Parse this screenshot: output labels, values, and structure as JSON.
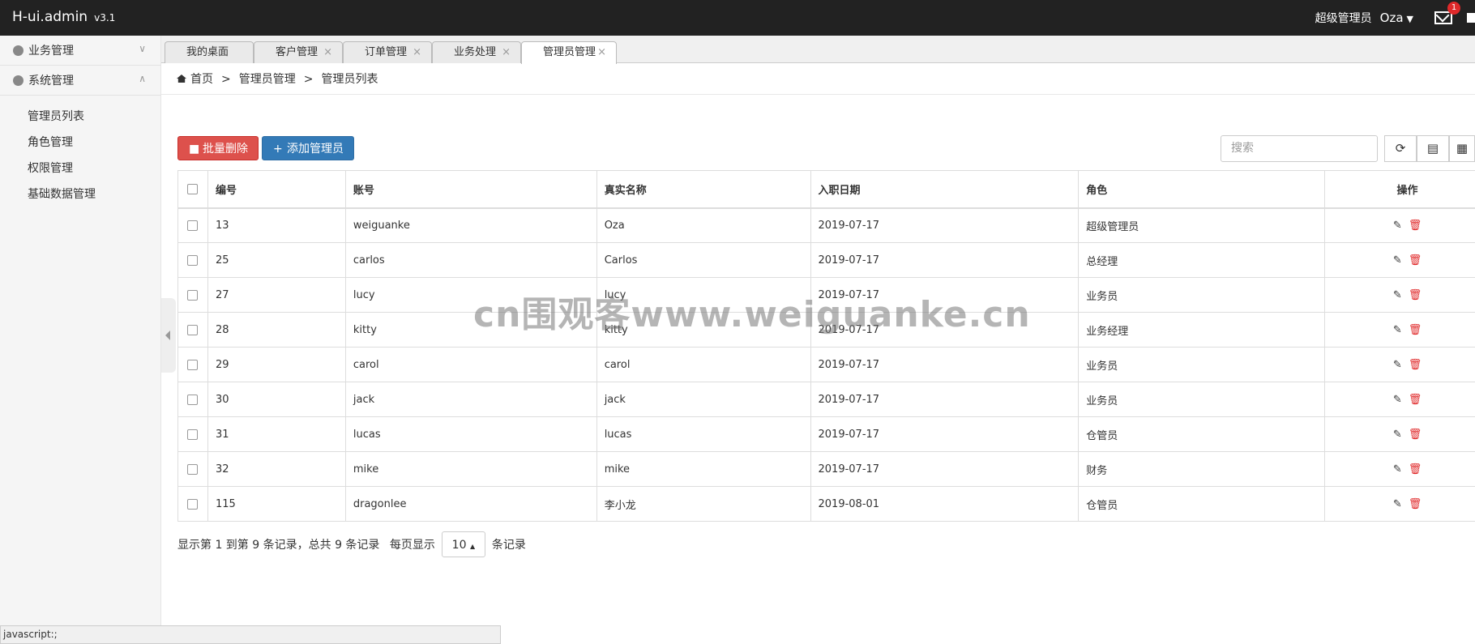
{
  "header": {
    "brand": "H-ui.admin",
    "version": "v3.1",
    "role": "超级管理员",
    "user": "Oza",
    "mail_badge": "1"
  },
  "sidebar": {
    "groups": [
      {
        "label": "业务管理",
        "icon": "user-icon",
        "expanded": false
      },
      {
        "label": "系统管理",
        "icon": "gear-icon",
        "expanded": true
      }
    ],
    "items": [
      "管理员列表",
      "角色管理",
      "权限管理",
      "基础数据管理"
    ]
  },
  "tabs": [
    {
      "label": "我的桌面",
      "closable": false
    },
    {
      "label": "客户管理",
      "closable": true
    },
    {
      "label": "订单管理",
      "closable": true
    },
    {
      "label": "业务处理",
      "closable": true
    },
    {
      "label": "管理员管理",
      "closable": true,
      "active": true
    }
  ],
  "breadcrumb": {
    "home": "首页",
    "level1": "管理员管理",
    "level2": "管理员列表",
    "sep": ">"
  },
  "toolbar": {
    "batch_delete": "批量删除",
    "add_admin": "添加管理员",
    "search_placeholder": "搜索"
  },
  "table": {
    "columns": [
      "编号",
      "账号",
      "真实名称",
      "入职日期",
      "角色",
      "操作"
    ],
    "rows": [
      {
        "id": "13",
        "account": "weiguanke",
        "name": "Oza",
        "date": "2019-07-17",
        "role": "超级管理员"
      },
      {
        "id": "25",
        "account": "carlos",
        "name": "Carlos",
        "date": "2019-07-17",
        "role": "总经理"
      },
      {
        "id": "27",
        "account": "lucy",
        "name": "lucy",
        "date": "2019-07-17",
        "role": "业务员"
      },
      {
        "id": "28",
        "account": "kitty",
        "name": "kitty",
        "date": "2019-07-17",
        "role": "业务经理"
      },
      {
        "id": "29",
        "account": "carol",
        "name": "carol",
        "date": "2019-07-17",
        "role": "业务员"
      },
      {
        "id": "30",
        "account": "jack",
        "name": "jack",
        "date": "2019-07-17",
        "role": "业务员"
      },
      {
        "id": "31",
        "account": "lucas",
        "name": "lucas",
        "date": "2019-07-17",
        "role": "仓管员"
      },
      {
        "id": "32",
        "account": "mike",
        "name": "mike",
        "date": "2019-07-17",
        "role": "财务"
      },
      {
        "id": "115",
        "account": "dragonlee",
        "name": "李小龙",
        "date": "2019-08-01",
        "role": "仓管员"
      }
    ]
  },
  "pager": {
    "summary": "显示第 1 到第 9 条记录，总共 9 条记录",
    "per_page_label": "每页显示",
    "page_size": "10",
    "suffix": "条记录"
  },
  "watermark": "cn围观客www.weiguanke.cn",
  "status_bar": "javascript:;"
}
